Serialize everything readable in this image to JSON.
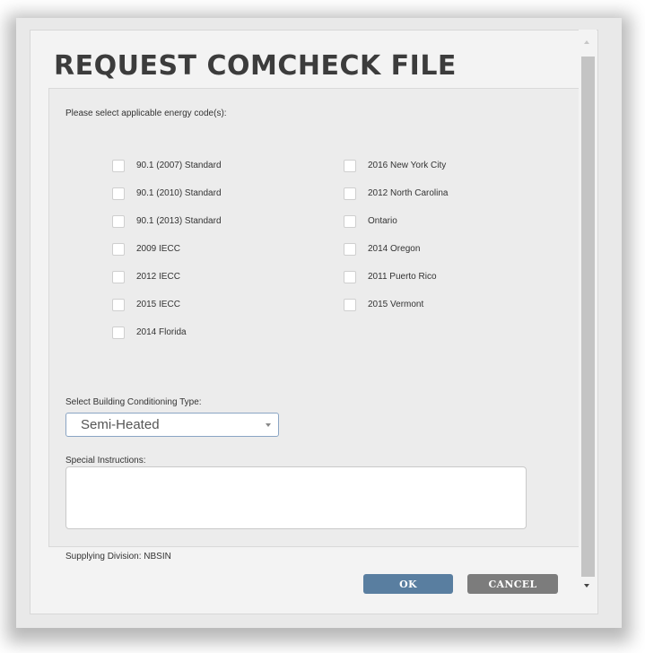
{
  "dialog": {
    "title": "REQUEST COMCHECK FILE"
  },
  "form": {
    "prompt": "Please select applicable energy code(s):",
    "codes_left": [
      {
        "label": "90.1 (2007) Standard",
        "checked": false
      },
      {
        "label": "90.1 (2010) Standard",
        "checked": false
      },
      {
        "label": "90.1 (2013) Standard",
        "checked": false
      },
      {
        "label": "2009 IECC",
        "checked": false
      },
      {
        "label": "2012 IECC",
        "checked": false
      },
      {
        "label": "2015 IECC",
        "checked": false
      },
      {
        "label": "2014 Florida",
        "checked": false
      }
    ],
    "codes_right": [
      {
        "label": "2016 New York City",
        "checked": false
      },
      {
        "label": "2012 North Carolina",
        "checked": false
      },
      {
        "label": "Ontario",
        "checked": false
      },
      {
        "label": "2014 Oregon",
        "checked": false
      },
      {
        "label": "2011 Puerto Rico",
        "checked": false
      },
      {
        "label": "2015 Vermont",
        "checked": false
      }
    ],
    "conditioning_label": "Select Building Conditioning Type:",
    "conditioning_value": "Semi-Heated",
    "instructions_label": "Special Instructions:",
    "instructions_value": "",
    "division_text": "Supplying Division:  NBSIN"
  },
  "buttons": {
    "ok": "OK",
    "cancel": "CANCEL"
  },
  "icons": {
    "select_arrow": "chevron-down-icon",
    "scroll_up": "scroll-up-icon",
    "scroll_down": "scroll-down-icon"
  },
  "colors": {
    "ok_button": "#597ea0",
    "cancel_button": "#7c7c7c",
    "title": "#3c3c3c",
    "panel": "#ececec"
  }
}
